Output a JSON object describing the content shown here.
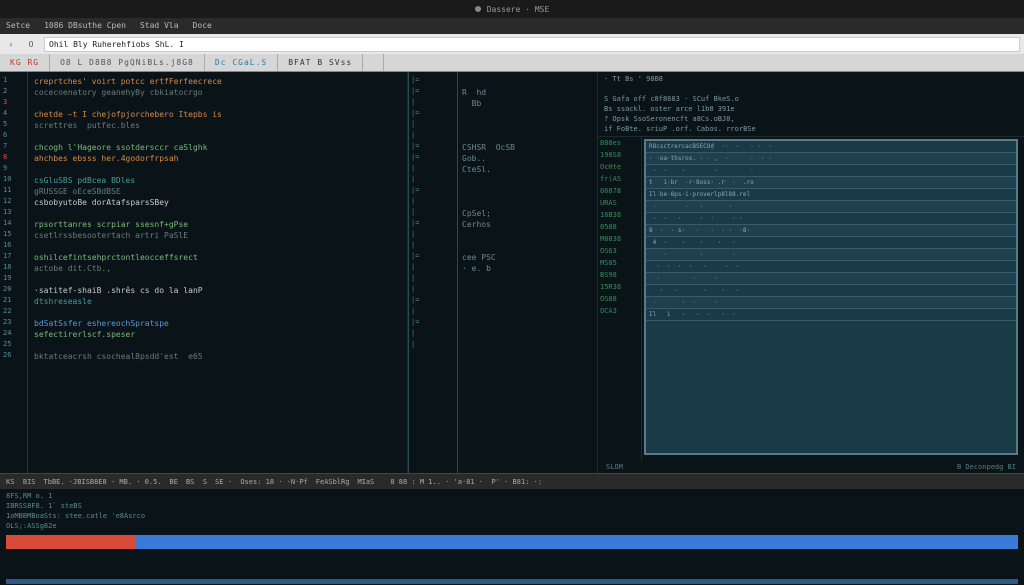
{
  "top": {
    "title": "Dassere · MSE"
  },
  "menu": {
    "items": [
      "Setce",
      "1086  DBsuthe Cpen",
      "Stad  Vla",
      "Doce",
      "",
      ""
    ]
  },
  "address": {
    "back": "‹",
    "fwd": "O",
    "url": "Ohil  Bly  Ruherehfiobs ShL. I"
  },
  "tabs": {
    "items": [
      "KG  RG",
      "O8 L D8B8  PgQNiBLs.j8G8",
      "Dc  CGaL.S",
      "BFAT  B SVss",
      "",
      ""
    ]
  },
  "gutter_lines": [
    "1",
    "2",
    "3",
    "4",
    "5",
    "6",
    "7",
    "8",
    "9",
    "10",
    "11",
    "12",
    "13",
    "14",
    "15",
    "16",
    "17",
    "18",
    "19",
    "20",
    "21",
    "22",
    "23",
    "24",
    "25",
    "26"
  ],
  "code": [
    {
      "cls": "c-orange",
      "t": "creprtches' voirt potcc ertfFerfeecrece"
    },
    {
      "cls": "c-gray",
      "t": "cocecoenatory geanehyBy cbkiatocrgo"
    },
    {
      "cls": "c-gray",
      "t": ""
    },
    {
      "cls": "c-orange",
      "t": "chetde ̵t I chejofpjorchebero Itepbs is"
    },
    {
      "cls": "c-gray",
      "t": "screttres  putfec.bles"
    },
    {
      "cls": "c-gray",
      "t": ""
    },
    {
      "cls": "c-green",
      "t": "chcogh l'Hageore ssotdersccr caSlghk"
    },
    {
      "cls": "c-orange",
      "t": "ahchbes ebsss her.4godorfrpsah"
    },
    {
      "cls": "c-gray",
      "t": ""
    },
    {
      "cls": "c-teal",
      "t": "csGluSBS pdBcea BDles"
    },
    {
      "cls": "c-gray",
      "t": "gRUSSGE oEceSBdBSE"
    },
    {
      "cls": "c-white",
      "t": "csbobyutoBe dorAtafsparsSBey"
    },
    {
      "cls": "c-gray",
      "t": ""
    },
    {
      "cls": "c-green",
      "t": "rpsorttanres scrpiar ssesnf+gPse"
    },
    {
      "cls": "c-gray",
      "t": "csetlrssbesootertach artri PaSlE"
    },
    {
      "cls": "c-gray",
      "t": ""
    },
    {
      "cls": "c-green",
      "t": "oshilcefintsehprctontleocceffsrect"
    },
    {
      "cls": "c-gray",
      "t": "actobe dit.Ctb.,"
    },
    {
      "cls": "c-gray",
      "t": ""
    },
    {
      "cls": "c-white",
      "t": "·satitef-shaiB .shrês cs do la lanP"
    },
    {
      "cls": "c-teal",
      "t": "dtshreseasle"
    },
    {
      "cls": "c-gray",
      "t": ""
    },
    {
      "cls": "c-blue",
      "t": "bdSatSsfer eshereochSpratspe"
    },
    {
      "cls": "c-green",
      "t": "sefectirerlscf.speser"
    },
    {
      "cls": "c-gray",
      "t": ""
    },
    {
      "cls": "c-gray",
      "t": "bktatceacrsh csocheal8psdd'est  e65"
    }
  ],
  "mid_marks": [
    "|=",
    "|=",
    "|",
    "|=",
    "|",
    "|",
    "|=",
    "|=",
    "|",
    "|",
    "|=",
    "|",
    "|",
    "|=",
    "|",
    "|",
    "|=",
    "|",
    "|",
    "|",
    "|=",
    "|",
    "|=",
    "|",
    "|",
    ""
  ],
  "mid2": [
    "",
    "R  hd",
    "  Bb",
    "",
    "",
    "",
    "CSHSR  OcSB",
    "Gob..",
    "CteSl.",
    "",
    "",
    "",
    "CpSel;",
    "Cerhos",
    "",
    "",
    "cee PSC",
    "· e. b",
    "",
    "",
    "",
    "",
    "",
    "",
    "",
    ""
  ],
  "right": {
    "header": [
      "· Tt  Bs ' 98B8",
      "",
      "S  Gafa  off c8f8683 · SCuf BkeS.o",
      "Bs  ssackl. oster arce l1b8 391e",
      "? Opsk  SsoSeronencft a8Cs.oBJ8,",
      "if  FoBte.  sriuP .orf.  Cabos. rrorBSe"
    ],
    "gutter": [
      "B88es",
      "198S8",
      "OcHte",
      "fr(AS",
      "06878",
      "URAS",
      "16B38",
      "0588",
      "M8838",
      "OS63",
      "MS85",
      "BS98",
      "15R38",
      "OS88",
      "OCA3"
    ],
    "rows": [
      "R8csctrercacBSECOḍ  ··  ·   · ·  ·",
      "· ·oa·thsros. · · ,  ·      ·  · ·",
      " ·  ·    ·        ·         ·",
      "t   i·br  ·r·8oss· .r  ·  .ro",
      "Il·be·8ps·i·proverlp8l88.rel",
      " ·        ·   ·       ·",
      " ·  ·   ·     ·  ·     · ·",
      "8  ·  · s·   ·   ·  · ·  ·8·",
      " 4  ·    ·    ·    ·   ·",
      "    ·         ·        ·",
      "  ·  ·  ·  ·   ·     ·  ·",
      "  ·         ·     ·",
      "   ·   ·       ·    ·   ·",
      " ·       ·  ·     ·",
      "Il   i   ·   ·  ·   ·  ·"
    ],
    "foot_left": "SLOM",
    "foot_right": "B   Deconpedg BI"
  },
  "status": {
    "segments": [
      "KS  BIS",
      "TbBE. ·JBISB8E8 · MB. · 0.5.",
      "BE",
      "BS  S",
      "SE ·  Oses: 18 · ·N·Pf",
      "FeASblRg",
      "MIaS",
      "",
      "8 88 : M 1.. · 'a·81 ·  P' · B81: ·:"
    ]
  },
  "bottom": {
    "lines": [
      "8FS,RM  o. 1",
      "IBRSS8F8. 1` steBS",
      "1oMBBMBoaSts: stee.catle  'e8Asrco",
      "OLS;:ASSg82e"
    ],
    "bar_label_left": "· red segment",
    "bar_label_right": "blue segment"
  }
}
